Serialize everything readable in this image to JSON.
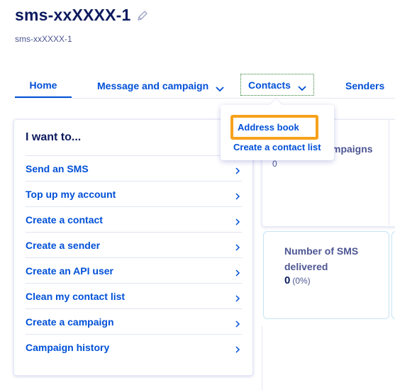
{
  "header": {
    "title": "sms-xxXXXX-1",
    "subtitle": "sms-xxXXXX-1"
  },
  "tabs": [
    {
      "label": "Home"
    },
    {
      "label": "Message and campaign"
    },
    {
      "label": "Contacts"
    },
    {
      "label": "Senders"
    }
  ],
  "dropdown": {
    "items": [
      {
        "label": "Address book"
      },
      {
        "label": "Create a contact list"
      }
    ]
  },
  "iwant": {
    "heading": "I want to...",
    "items": [
      {
        "label": "Send an SMS"
      },
      {
        "label": "Top up my account"
      },
      {
        "label": "Create a contact"
      },
      {
        "label": "Create a sender"
      },
      {
        "label": "Create an API user"
      },
      {
        "label": "Clean my contact list"
      },
      {
        "label": "Create a campaign"
      },
      {
        "label": "Campaign history"
      }
    ]
  },
  "stats": {
    "campaigns_label_fragment": "mpaigns",
    "campaigns_value": "0",
    "sms_delivered_label": "Number of SMS delivered",
    "sms_delivered_value": "0",
    "sms_delivered_pct": "(0%)"
  },
  "colors": {
    "accent": "#0050d7",
    "title": "#0d1b5e",
    "highlight": "#f7a11a"
  },
  "icons": {
    "edit": "pencil-icon",
    "chevron": "chevron-down-icon",
    "arrow": "chevron-right-icon"
  }
}
